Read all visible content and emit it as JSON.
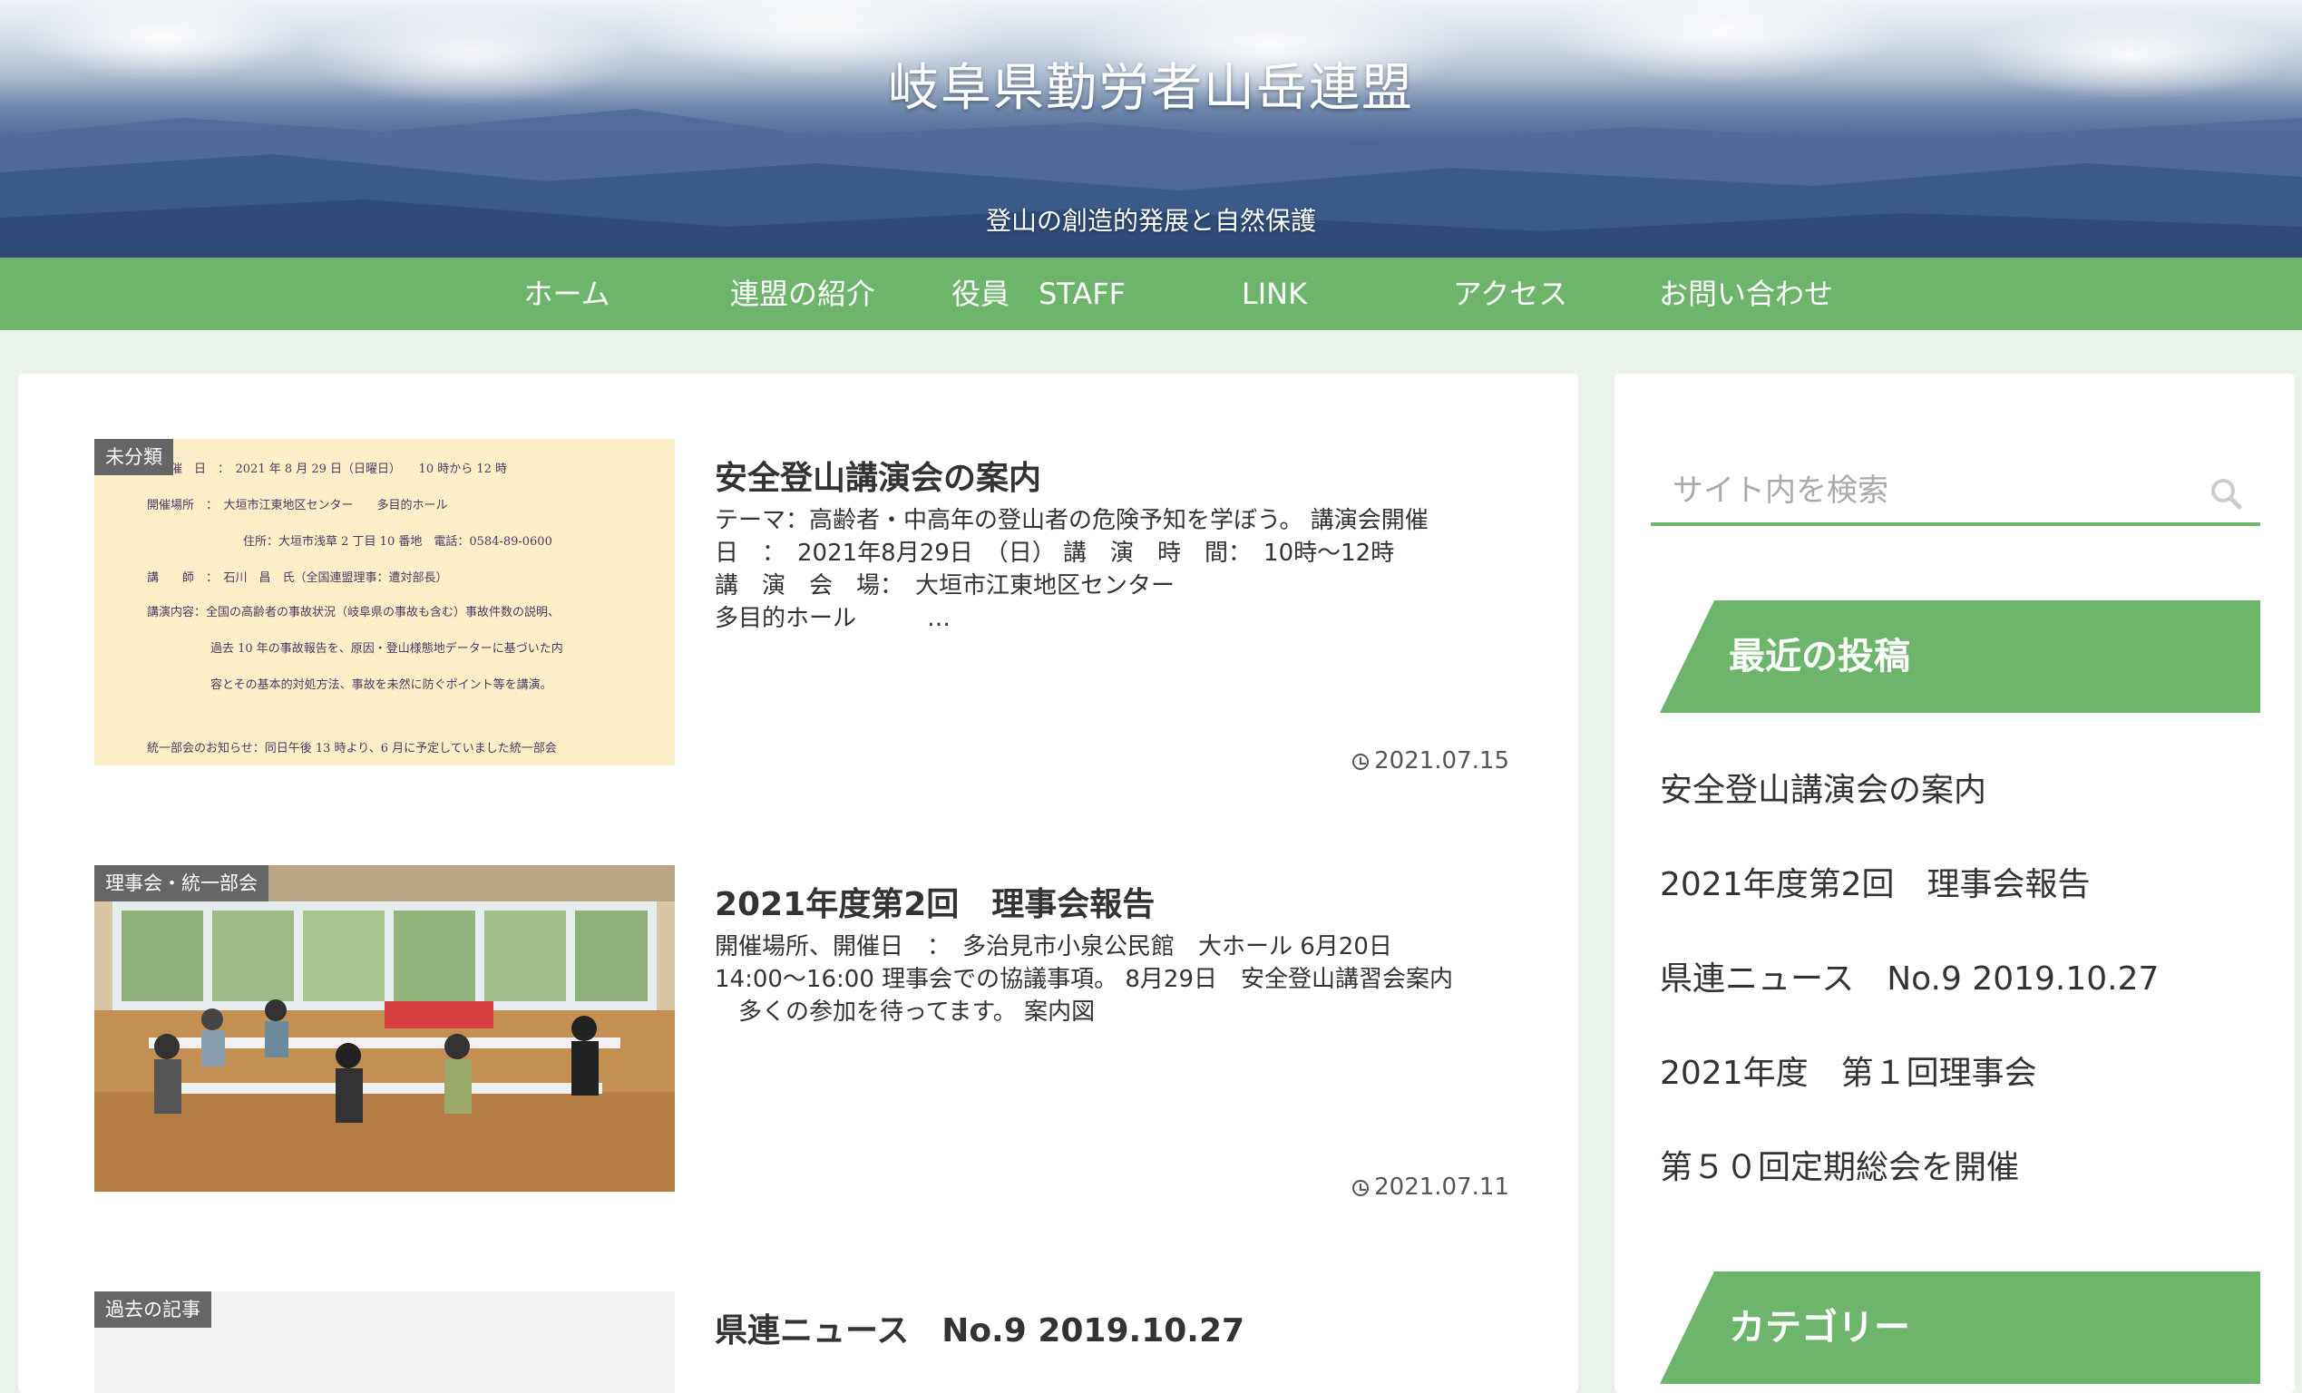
{
  "header": {
    "title": "岐阜県勤労者山岳連盟",
    "description": "登山の創造的発展と自然保護"
  },
  "nav": {
    "items": [
      "ホーム",
      "連盟の紹介",
      "役員　STAFF",
      "LINK",
      "アクセス",
      "お問い合わせ"
    ]
  },
  "colors": {
    "accent": "#6db56b",
    "background": "#eaf3e9"
  },
  "posts": [
    {
      "category": "未分類",
      "title": "安全登山講演会の案内",
      "excerpt": [
        "テーマ：高齢者・中高年の登山者の危険予知を学ぼう。 講演会開催",
        "日　：　2021年8月29日　（日） 講　演　時　間：　10時〜12時",
        "講　演　会　場：　大垣市江東地区センター",
        "多目的ホール　　　…"
      ],
      "date": "2021.07.15",
      "thumb_doc": [
        "開　催　日　：　2021 年 8 月 29 日（日曜日）　　10 時から 12 時",
        "開催場所　：　大垣市江東地区センター　　多目的ホール",
        "住所：大垣市浅草 2 丁目 10 番地　電話：0584-89-0600",
        "講　　師　：　石川　昌　氏（全国連盟理事：遭対部長）",
        "講演内容：全国の高齢者の事故状況（岐阜県の事故も含む）事故件数の説明、",
        "過去 10 年の事故報告を、原因・登山様態地データーに基づいた内",
        "容とその基本的対処方法、事故を未然に防ぐポイント等を講演。",
        "統一部会のお知らせ：同日午後 13 時より、6 月に予定していました統一部会"
      ]
    },
    {
      "category": "理事会・統一部会",
      "title": "2021年度第2回　理事会報告",
      "excerpt": [
        "開催場所、開催日　：　多治見市小泉公民館　大ホール 6月20日",
        "14:00〜16:00 理事会での協議事項。 8月29日　安全登山講習会案内",
        "　多くの参加を待ってます。 案内図"
      ],
      "date": "2021.07.11"
    },
    {
      "category": "過去の記事",
      "title": "県連ニュース　No.9 2019.10.27",
      "excerpt": [],
      "date": ""
    }
  ],
  "sidebar": {
    "search_placeholder": "サイト内を検索",
    "recent_title": "最近の投稿",
    "recent": [
      "安全登山講演会の案内",
      "2021年度第2回　理事会報告",
      "県連ニュース　No.9 2019.10.27",
      "2021年度　第１回理事会",
      "第５０回定期総会を開催"
    ],
    "category_title": "カテゴリー"
  }
}
